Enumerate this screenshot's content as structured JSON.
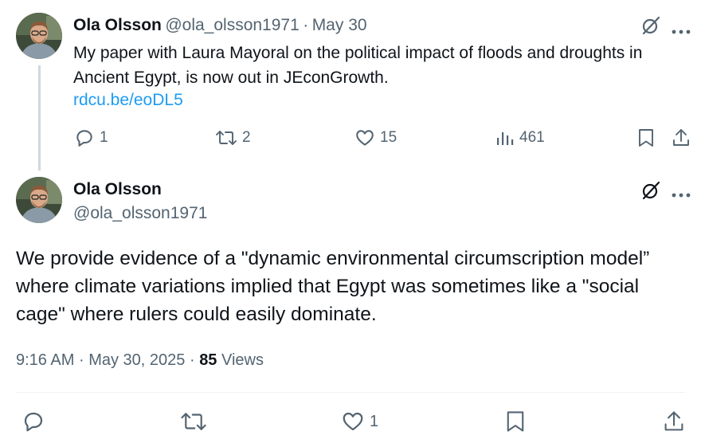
{
  "reply_tweet": {
    "name": "Ola Olsson",
    "handle": "@ola_olsson1971",
    "sep": "·",
    "date": "May 30",
    "text_line1": "My paper with Laura Mayoral on the political impact of floods and droughts in",
    "text_line2": "Ancient Egypt, is now out in JEconGrowth.",
    "link": "rdcu.be/eoDL5",
    "replies": "1",
    "reposts": "2",
    "likes": "15",
    "views": "461"
  },
  "main_tweet": {
    "name": "Ola Olsson",
    "handle": "@ola_olsson1971",
    "text_line1": "We provide evidence of a \"dynamic environmental circumscription model”",
    "text_line2": "where climate variations implied that Egypt was sometimes like a \"social",
    "text_line3": "cage\" where rulers could easily dominate.",
    "time": "9:16 AM",
    "sep": "·",
    "date": "May 30, 2025",
    "views_count": "85",
    "views_label": "Views",
    "likes": "1"
  },
  "icons": {
    "grok": "grok-icon",
    "more": "more-icon",
    "reply": "reply-icon",
    "repost": "repost-icon",
    "like": "heart-icon",
    "views": "views-icon",
    "bookmark": "bookmark-icon",
    "share": "share-icon"
  },
  "colors": {
    "text": "#0f1419",
    "muted": "#536471",
    "link": "#1d9bf0",
    "thread_line": "#cfd9de"
  }
}
